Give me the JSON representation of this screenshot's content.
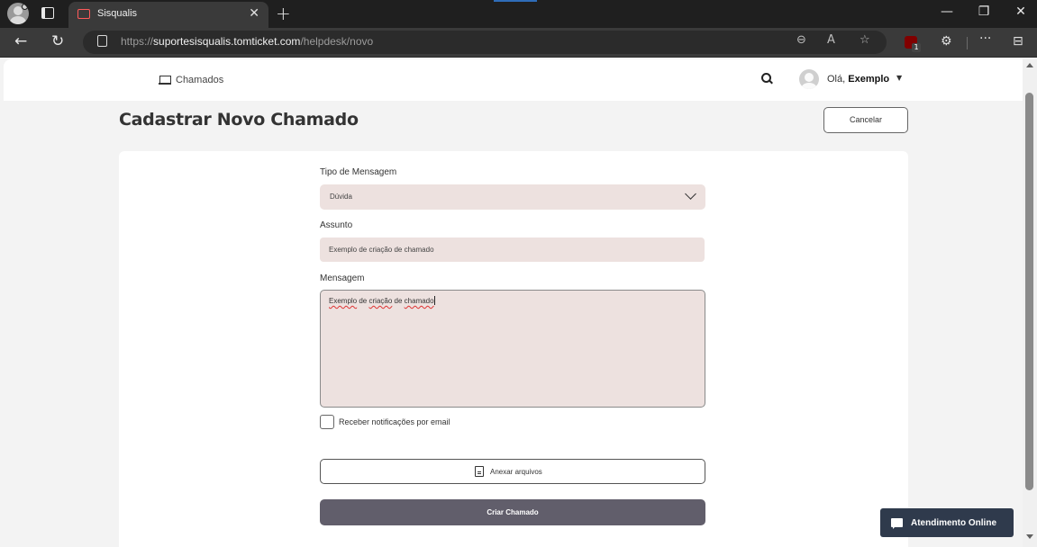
{
  "browser": {
    "tab_title": "Sisqualis",
    "url_scheme": "https://",
    "url_host": "suportesisqualis.tomticket.com",
    "url_path": "/helpdesk/novo",
    "extension_badge": "1"
  },
  "nav": {
    "chamados_label": "Chamados",
    "greeting": "Olá,",
    "user_name": "Exemplo"
  },
  "page": {
    "title": "Cadastrar Novo Chamado",
    "cancel_label": "Cancelar"
  },
  "form": {
    "tipo_label": "Tipo de Mensagem",
    "tipo_value": "Dúvida",
    "assunto_label": "Assunto",
    "assunto_value": "Exemplo de criação de chamado",
    "mensagem_label": "Mensagem",
    "mensagem_words": [
      "Exemplo",
      "de",
      "criação",
      "de",
      "chamado"
    ],
    "notify_label": "Receber notificações por email",
    "notify_checked": false,
    "attach_label": "Anexar arquivos",
    "submit_label": "Criar Chamado"
  },
  "chat": {
    "label": "Atendimento Online"
  },
  "colors": {
    "field_bg": "#ede1df",
    "submit_bg": "#615e6b",
    "chat_bg": "#2f3a4c"
  }
}
